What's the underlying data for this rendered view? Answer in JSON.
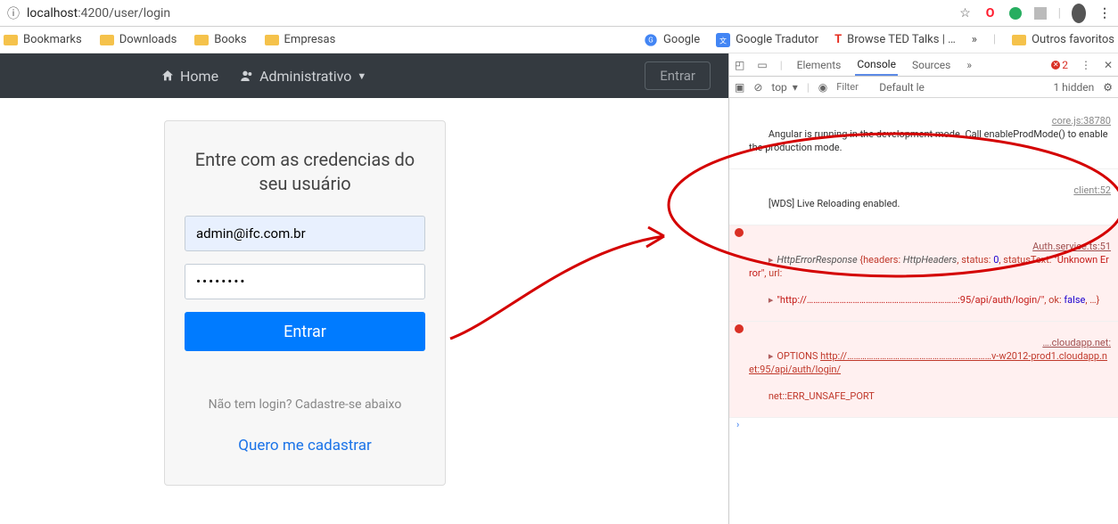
{
  "addr": {
    "scheme": "ⓘ",
    "host": "localhost",
    "port_path": ":4200/user/login"
  },
  "bookmarks": {
    "left": [
      "Bookmarks",
      "Downloads",
      "Books",
      "Empresas"
    ],
    "right": [
      {
        "label": "Google",
        "kind": "google"
      },
      {
        "label": "Google Tradutor",
        "kind": "translate"
      },
      {
        "label": "Browse TED Talks | …",
        "kind": "ted"
      }
    ],
    "other": "Outros favoritos",
    "more": "»"
  },
  "nav": {
    "home": "Home",
    "admin": "Administrativo",
    "login_btn": "Entrar"
  },
  "login": {
    "title": "Entre com as credencias do seu usuário",
    "email": "admin@ifc.com.br",
    "password": "••••••••",
    "submit": "Entrar",
    "sub": "Não tem login? Cadastre-se abaixo",
    "link": "Quero me cadastrar"
  },
  "devtools": {
    "tabs": [
      "Elements",
      "Console",
      "Sources"
    ],
    "tabs_more": "»",
    "err_count": "2",
    "menu": "⋮",
    "toolbar": {
      "top": "top",
      "dropdown": "▾",
      "eye": "◉",
      "filter_ph": "Filter",
      "default": "Default le",
      "hidden": "1 hidden",
      "gear": "⚙"
    },
    "rows": {
      "r0_text": "Angular is running in the development mode. Call enableProdMode() to enable the production mode.",
      "r0_src": "core.js:38780",
      "r1_text": "[WDS] Live Reloading enabled.",
      "r1_src": "client:52",
      "r2_src": "Auth.service.ts:51",
      "r2_line1_a": "HttpErrorResponse ",
      "r2_line1_b": "{headers: ",
      "r2_line1_c": "HttpHeaders",
      "r2_line1_d": ", status: ",
      "r2_line1_e": "0",
      "r2_line1_f": ", statusText: ",
      "r2_line1_g": "\"Unknown Error\"",
      "r2_line1_h": ", url:",
      "r2_line2_a": "\"http://……………………………………………………………:95/api/auth/login/\"",
      "r2_line2_b": ", ok: ",
      "r2_line2_c": "false",
      "r2_line2_d": ", …}",
      "r3_src": "….cloudapp.net:",
      "r3_line1_a": "OPTIONS ",
      "r3_line1_b": "http://…………………………………………………………v-w2012-prod1.cloudapp.net:95/api/auth/login/",
      "r3_line2": "net::ERR_UNSAFE_PORT"
    },
    "prompt": "›"
  }
}
